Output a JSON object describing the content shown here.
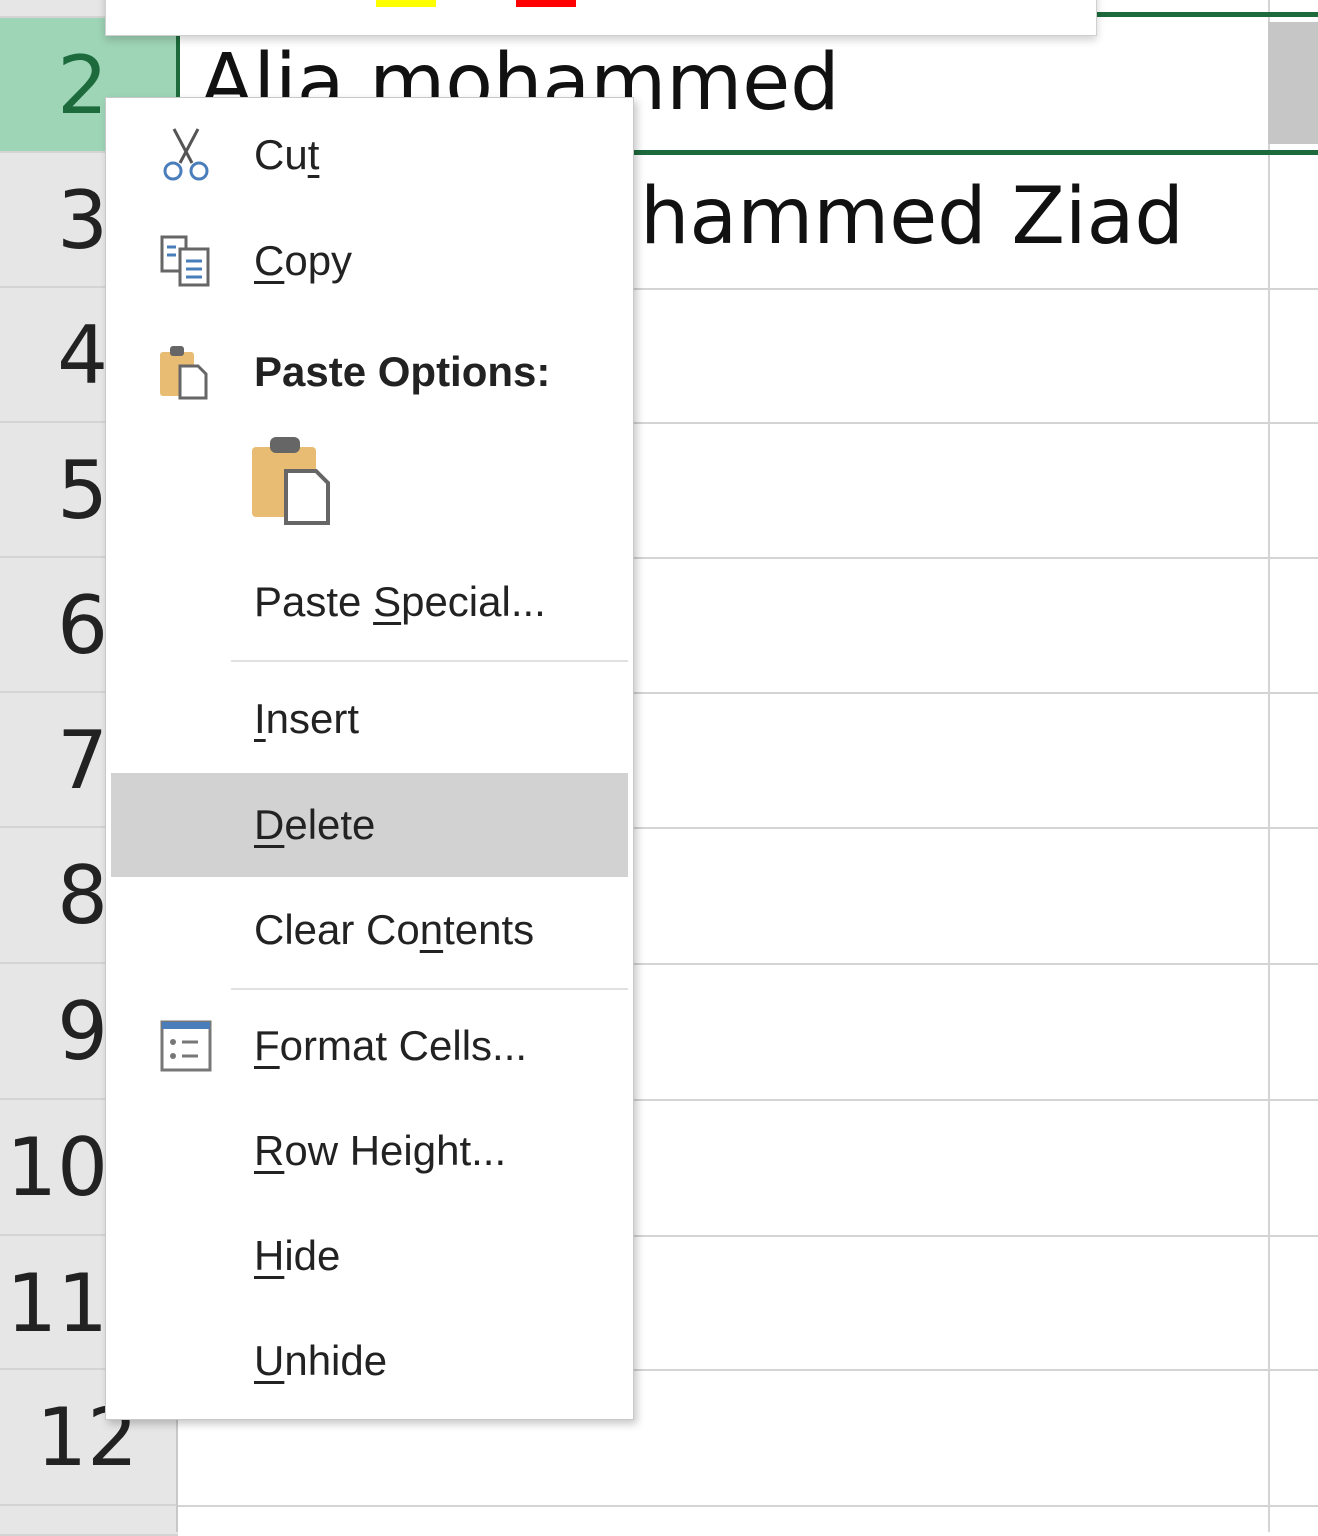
{
  "rows": [
    {
      "num": "2",
      "selected": true,
      "cell": "Alia mohammed"
    },
    {
      "num": "3",
      "selected": false,
      "cell": "hammed Ziad"
    },
    {
      "num": "4"
    },
    {
      "num": "5"
    },
    {
      "num": "6"
    },
    {
      "num": "7"
    },
    {
      "num": "8"
    },
    {
      "num": "9"
    },
    {
      "num": "10"
    },
    {
      "num": "11"
    },
    {
      "num": "12"
    }
  ],
  "colors": {
    "selection": "#1d6b3d",
    "selected_header": "#9fd5b7",
    "highlight": "#d2d2d2",
    "swatch_yellow": "#ffff00",
    "swatch_red": "#ff0000"
  },
  "menu": {
    "cut": {
      "pre": "Cu",
      "key": "t",
      "post": "",
      "icon": "scissors-icon"
    },
    "copy": {
      "pre": "",
      "key": "C",
      "post": "opy",
      "icon": "copy-icon"
    },
    "paste_header": "Paste Options:",
    "paste_special": {
      "pre": "Paste ",
      "key": "S",
      "post": "pecial..."
    },
    "insert": {
      "pre": "",
      "key": "I",
      "post": "nsert"
    },
    "delete": {
      "pre": "",
      "key": "D",
      "post": "elete",
      "highlighted": true
    },
    "clear": {
      "pre": "Clear Co",
      "key": "n",
      "post": "tents"
    },
    "format": {
      "pre": "",
      "key": "F",
      "post": "ormat Cells...",
      "icon": "format-cells-icon"
    },
    "row_height": {
      "pre": "",
      "key": "R",
      "post": "ow Height..."
    },
    "hide": {
      "pre": "",
      "key": "H",
      "post": "ide"
    },
    "unhide": {
      "pre": "",
      "key": "U",
      "post": "nhide"
    }
  }
}
